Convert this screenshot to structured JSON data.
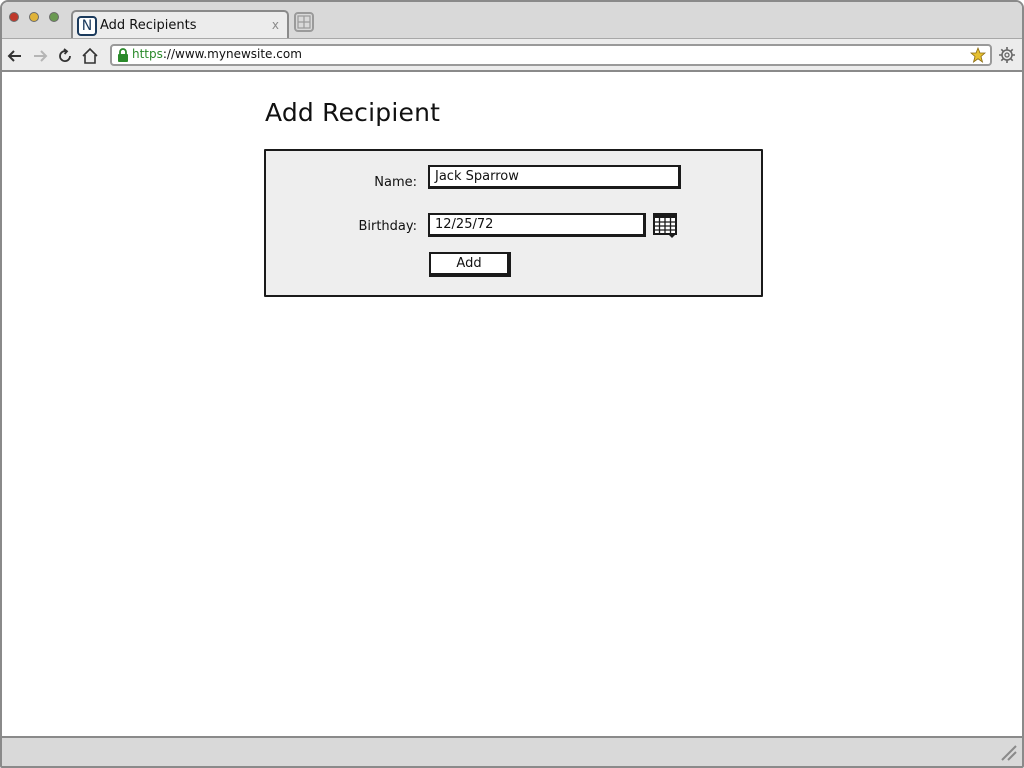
{
  "window": {
    "traffic_lights": [
      "close",
      "minimize",
      "maximize"
    ]
  },
  "tab": {
    "favicon_letter": "N",
    "title": "Add Recipients",
    "close_glyph": "x"
  },
  "toolbar": {
    "url_scheme": "https",
    "url_rest": "://www.mynewsite.com",
    "icons": [
      "back-arrow-icon",
      "forward-arrow-icon",
      "reload-icon",
      "home-icon",
      "lock-icon",
      "star-icon",
      "settings-gear-icon"
    ]
  },
  "page": {
    "title": "Add Recipient"
  },
  "form": {
    "name_label": "Name:",
    "name_value": "Jack Sparrow",
    "birthday_label": "Birthday:",
    "birthday_value": "12/25/72",
    "add_label": "Add"
  },
  "colors": {
    "panel_bg": "#eeeeee",
    "chrome_bg": "#d9d9d9",
    "secure_green": "#2a8a2a",
    "star_yellow": "#e6c030"
  }
}
